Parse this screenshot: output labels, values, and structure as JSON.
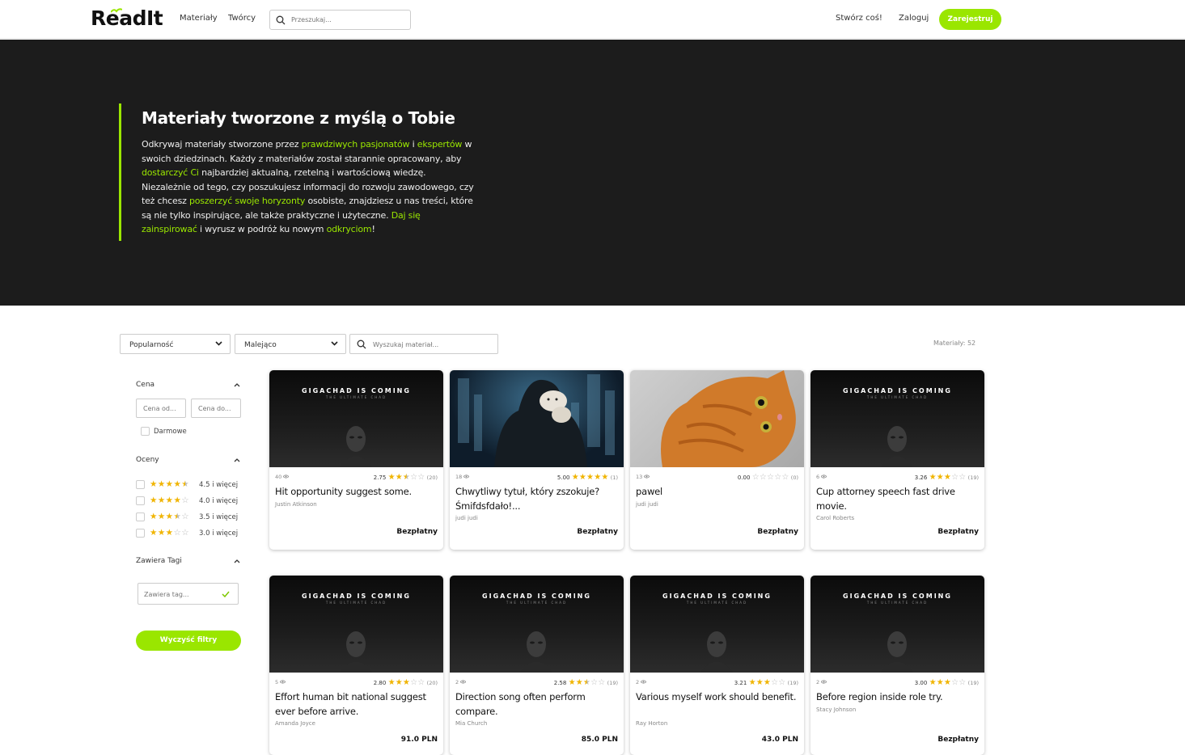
{
  "header": {
    "logo_text": "ReadIt",
    "nav": [
      "Materiały",
      "Twórcy"
    ],
    "search_placeholder": "Przeszukaj...",
    "create_label": "Stwórz coś!",
    "login_label": "Zaloguj",
    "register_label": "Zarejestruj",
    "accent_color": "#9ae600"
  },
  "hero": {
    "title": "Materiały tworzone z myślą o Tobie",
    "segments": [
      {
        "t": "Odkrywaj materiały stworzone przez ",
        "hl": false
      },
      {
        "t": "prawdziwych pasjonatów",
        "hl": true
      },
      {
        "t": " i ",
        "hl": false
      },
      {
        "t": "ekspertów",
        "hl": true
      },
      {
        "t": " w swoich dziedzinach. Każdy z materiałów został starannie opracowany, aby ",
        "hl": false
      },
      {
        "t": "dostarczyć Ci",
        "hl": true
      },
      {
        "t": " najbardziej aktualną, rzetelną i wartościową wiedzę. Niezależnie od tego, czy poszukujesz informacji do rozwoju zawodowego, czy też chcesz ",
        "hl": false
      },
      {
        "t": "poszerzyć swoje horyzonty",
        "hl": true
      },
      {
        "t": " osobiste, znajdziesz u nas treści, które są nie tylko inspirujące, ale także praktyczne i użyteczne. ",
        "hl": false
      },
      {
        "t": "Daj się zainspirować",
        "hl": true
      },
      {
        "t": " i wyrusz w podróż ku nowym ",
        "hl": false
      },
      {
        "t": "odkryciom",
        "hl": true
      },
      {
        "t": "!",
        "hl": false
      }
    ]
  },
  "toolbar": {
    "sort_value": "Popularność",
    "order_value": "Malejąco",
    "search_placeholder": "Wyszukaj materiał...",
    "count_text": "Materiały: 52"
  },
  "sidebar": {
    "price_heading": "Cena",
    "price_from_placeholder": "Cena od...",
    "price_to_placeholder": "Cena do...",
    "free_label": "Darmowe",
    "ratings_heading": "Oceny",
    "ratings": [
      {
        "stars": 4.5,
        "label": "4.5 i więcej"
      },
      {
        "stars": 4,
        "label": "4.0 i więcej"
      },
      {
        "stars": 3.5,
        "label": "3.5 i więcej"
      },
      {
        "stars": 3,
        "label": "3.0 i więcej"
      }
    ],
    "tags_heading": "Zawiera Tagi",
    "tags_placeholder": "Zawiera tag...",
    "clear_label": "Wyczyść filtry"
  },
  "thumb_text": {
    "title": "GIGACHAD IS COMING",
    "subtitle": "THE ULTIMATE CHAD"
  },
  "cards": [
    {
      "thumb": "gigachad",
      "views": "40",
      "rating_text": "2.75",
      "stars": 2.5,
      "count": "(20)",
      "title": "Hit opportunity suggest some.",
      "author": "Justin Atkinson",
      "price": "Bezpłatny"
    },
    {
      "thumb": "hoodie",
      "views": "18",
      "rating_text": "5.00",
      "stars": 5,
      "count": "(1)",
      "title": "Chwytliwy tytuł, który zszokuje? Śmifdsfdało!...",
      "author": "judi judi",
      "price": "Bezpłatny"
    },
    {
      "thumb": "cat",
      "views": "13",
      "rating_text": "0.00",
      "stars": 0,
      "count": "(0)",
      "title": "pawel",
      "author": "judi judi",
      "price": "Bezpłatny"
    },
    {
      "thumb": "gigachad",
      "views": "6",
      "rating_text": "3.26",
      "stars": 3,
      "count": "(19)",
      "title": "Cup attorney speech fast drive movie.",
      "author": "Carol Roberts",
      "price": "Bezpłatny"
    },
    {
      "thumb": "gigachad",
      "views": "5",
      "rating_text": "2.80",
      "stars": 3,
      "count": "(20)",
      "title": "Effort human bit national suggest ever before arrive.",
      "author": "Amanda Joyce",
      "price": "91.0 PLN"
    },
    {
      "thumb": "gigachad",
      "views": "2",
      "rating_text": "2.58",
      "stars": 2.5,
      "count": "(19)",
      "title": "Direction song often perform compare.",
      "author": "Mia Church",
      "price": "85.0 PLN"
    },
    {
      "thumb": "gigachad",
      "views": "2",
      "rating_text": "3.21",
      "stars": 3,
      "count": "(19)",
      "title": "Various myself work should benefit.",
      "author": "Ray Horton",
      "price": "43.0 PLN"
    },
    {
      "thumb": "gigachad",
      "views": "2",
      "rating_text": "3.00",
      "stars": 3,
      "count": "(19)",
      "title": "Before region inside role try.",
      "author": "Stacy Johnson",
      "price": "Bezpłatny"
    }
  ]
}
